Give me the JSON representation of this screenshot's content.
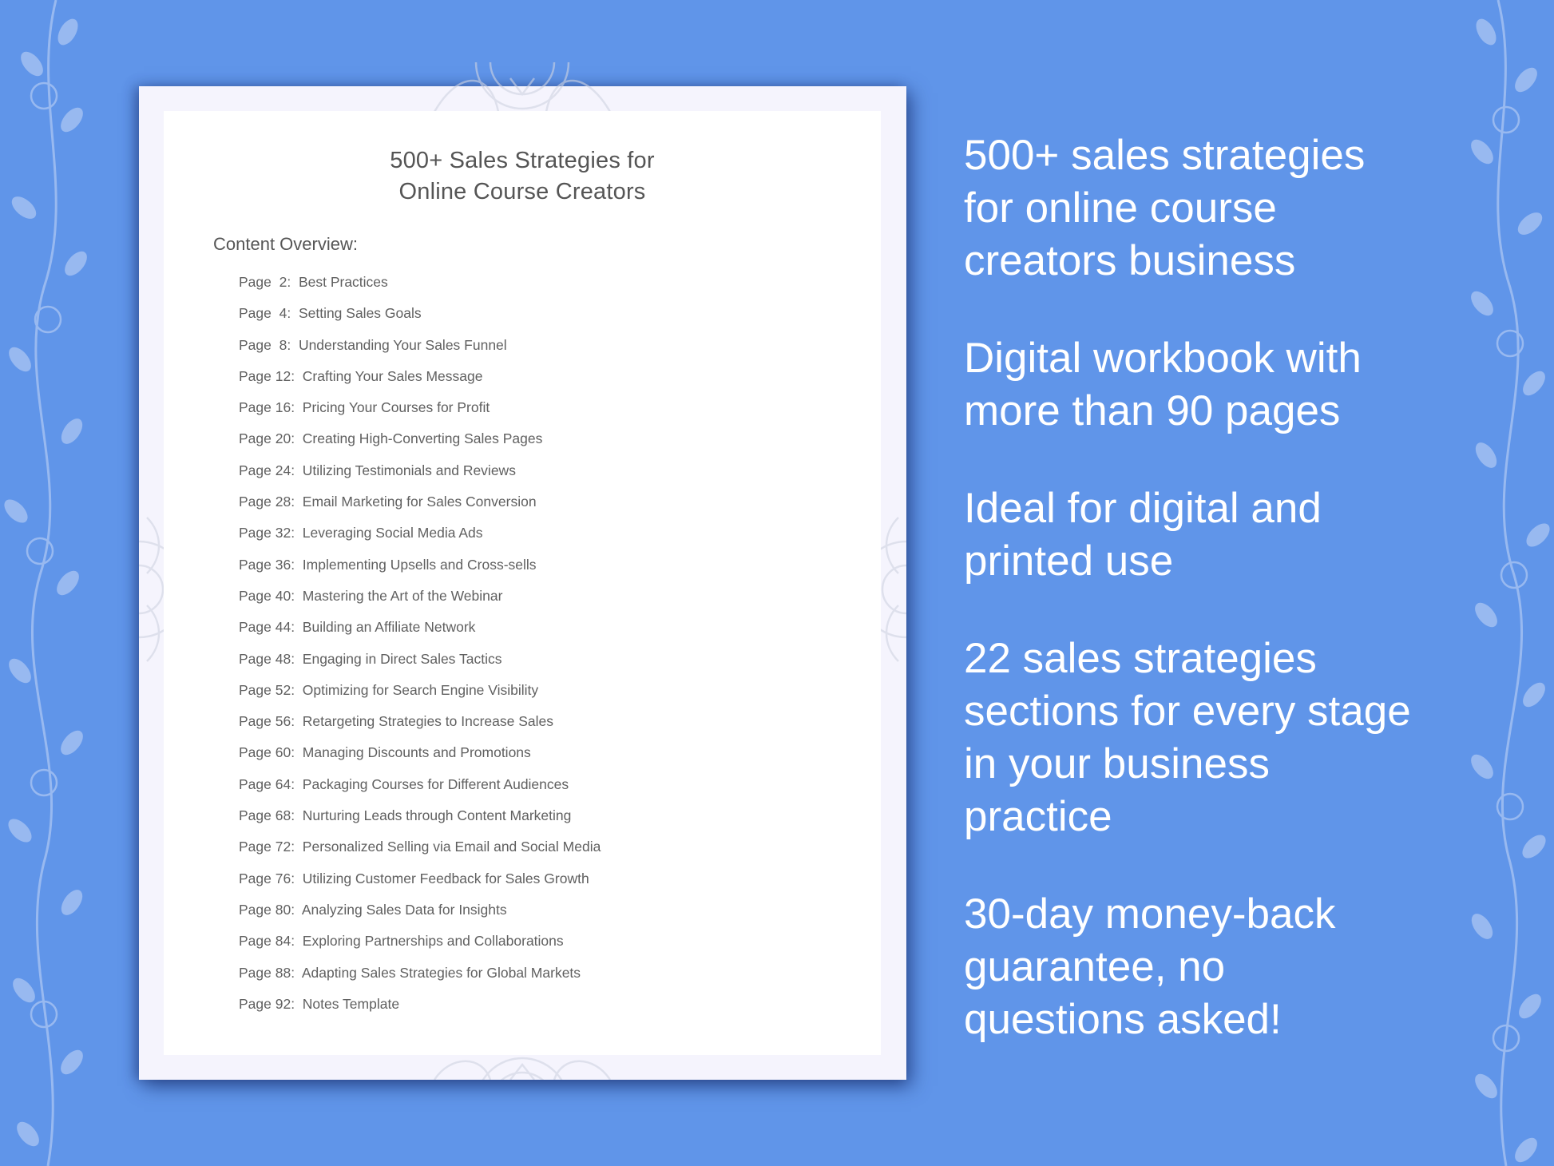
{
  "document": {
    "title_line1": "500+ Sales Strategies for",
    "title_line2": "Online Course Creators",
    "overview_label": "Content Overview:",
    "toc": [
      {
        "page": "Page  2:",
        "title": "Best Practices"
      },
      {
        "page": "Page  4:",
        "title": "Setting Sales Goals"
      },
      {
        "page": "Page  8:",
        "title": "Understanding Your Sales Funnel"
      },
      {
        "page": "Page 12:",
        "title": "Crafting Your Sales Message"
      },
      {
        "page": "Page 16:",
        "title": "Pricing Your Courses for Profit"
      },
      {
        "page": "Page 20:",
        "title": "Creating High-Converting Sales Pages"
      },
      {
        "page": "Page 24:",
        "title": "Utilizing Testimonials and Reviews"
      },
      {
        "page": "Page 28:",
        "title": "Email Marketing for Sales Conversion"
      },
      {
        "page": "Page 32:",
        "title": "Leveraging Social Media Ads"
      },
      {
        "page": "Page 36:",
        "title": "Implementing Upsells and Cross-sells"
      },
      {
        "page": "Page 40:",
        "title": "Mastering the Art of the Webinar"
      },
      {
        "page": "Page 44:",
        "title": "Building an Affiliate Network"
      },
      {
        "page": "Page 48:",
        "title": "Engaging in Direct Sales Tactics"
      },
      {
        "page": "Page 52:",
        "title": "Optimizing for Search Engine Visibility"
      },
      {
        "page": "Page 56:",
        "title": "Retargeting Strategies to Increase Sales"
      },
      {
        "page": "Page 60:",
        "title": "Managing Discounts and Promotions"
      },
      {
        "page": "Page 64:",
        "title": "Packaging Courses for Different Audiences"
      },
      {
        "page": "Page 68:",
        "title": "Nurturing Leads through Content Marketing"
      },
      {
        "page": "Page 72:",
        "title": "Personalized Selling via Email and Social Media"
      },
      {
        "page": "Page 76:",
        "title": "Utilizing Customer Feedback for Sales Growth"
      },
      {
        "page": "Page 80:",
        "title": "Analyzing Sales Data for Insights"
      },
      {
        "page": "Page 84:",
        "title": "Exploring Partnerships and Collaborations"
      },
      {
        "page": "Page 88:",
        "title": "Adapting Sales Strategies for Global Markets"
      },
      {
        "page": "Page 92:",
        "title": "Notes Template"
      }
    ]
  },
  "features": [
    {
      "lines": [
        "500+ sales strategies",
        "for online course",
        "creators business"
      ]
    },
    {
      "lines": [
        "Digital workbook with",
        "more than 90 pages"
      ]
    },
    {
      "lines": [
        "Ideal for digital and",
        "printed use"
      ]
    },
    {
      "lines": [
        "22 sales strategies",
        "sections for every stage",
        "in your business",
        "practice"
      ]
    },
    {
      "lines": [
        "30-day money-back",
        "guarantee, no",
        "questions asked!"
      ]
    }
  ],
  "colors": {
    "background": "#6095e9",
    "page": "#f5f4fd",
    "sheet": "#ffffff",
    "text_dark": "#555555",
    "text_light": "#ffffff"
  }
}
